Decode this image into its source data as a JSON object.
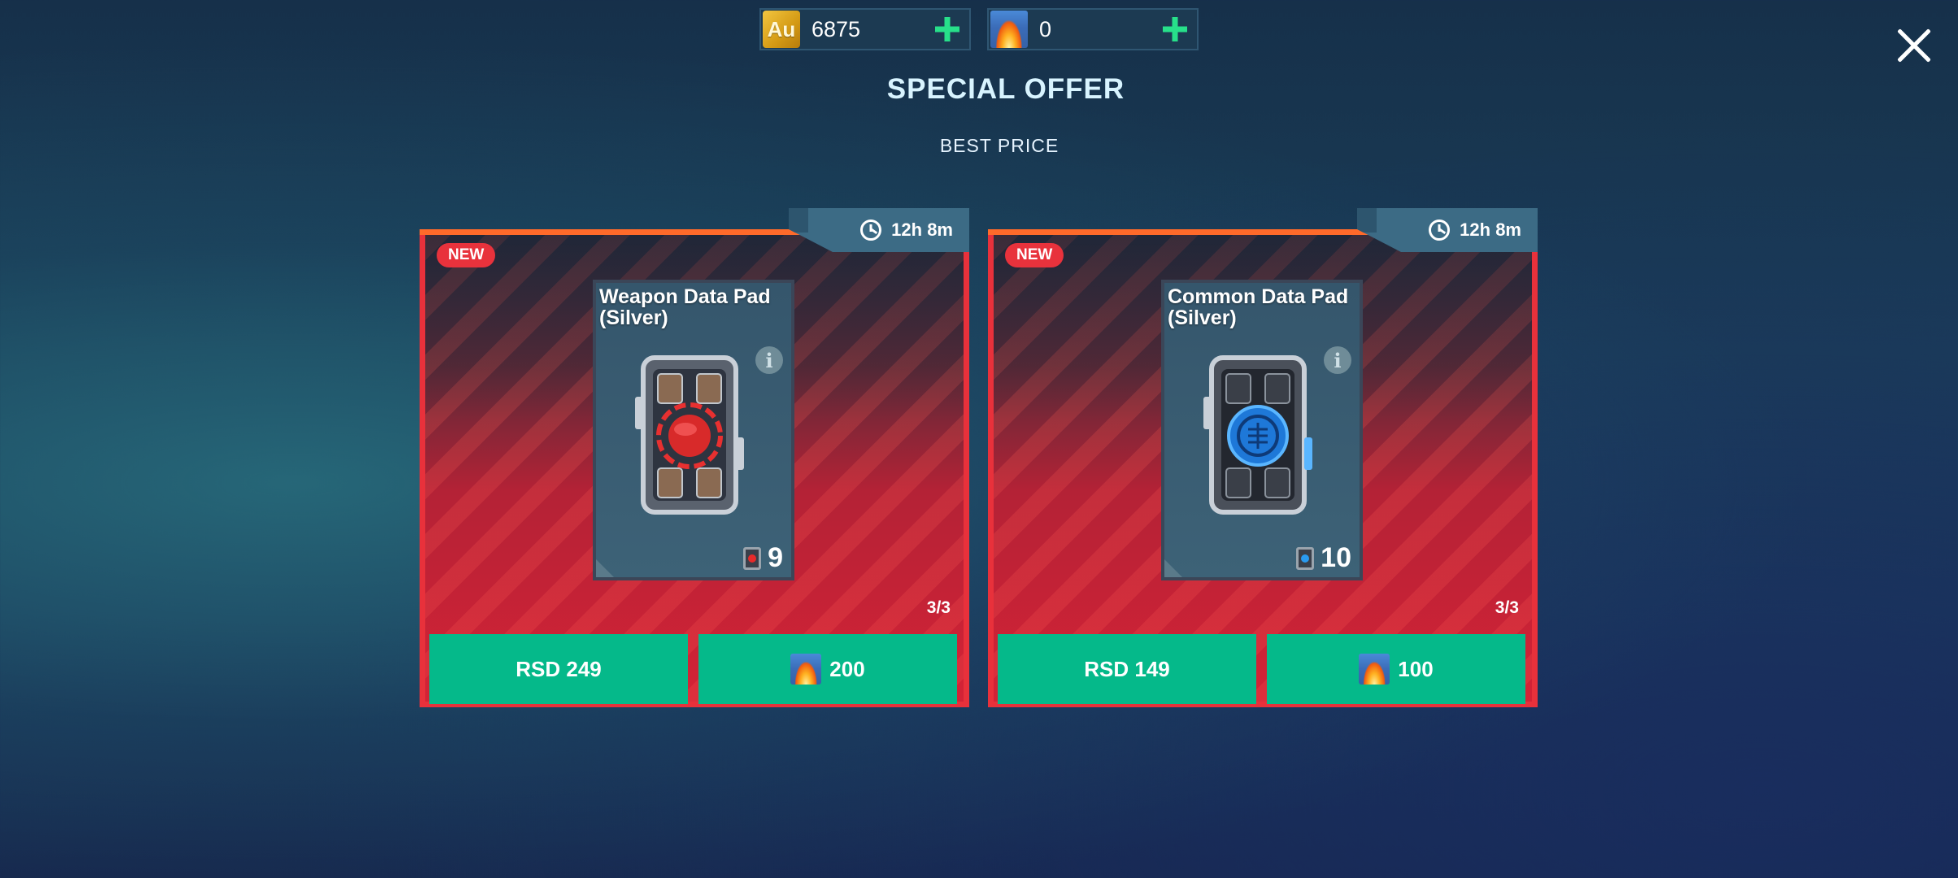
{
  "currencies": {
    "gold": {
      "icon_label": "Au",
      "value": "6875"
    },
    "gems": {
      "value": "0"
    }
  },
  "header": {
    "title": "SPECIAL OFFER",
    "subtitle": "BEST PRICE"
  },
  "offers": [
    {
      "badge": "NEW",
      "timer": "12h 8m",
      "name": "Weapon Data Pad (Silver)",
      "count": "9",
      "stock": "3/3",
      "price_money": "RSD 249",
      "price_gems": "200",
      "accent": "#e82a2a"
    },
    {
      "badge": "NEW",
      "timer": "12h 8m",
      "name": "Common Data Pad (Silver)",
      "count": "10",
      "stock": "3/3",
      "price_money": "RSD 149",
      "price_gems": "100",
      "accent": "#2a9af0"
    }
  ],
  "colors": {
    "buy_button": "#05b98a",
    "card_border": "#e8313b",
    "plus": "#27e08a"
  }
}
